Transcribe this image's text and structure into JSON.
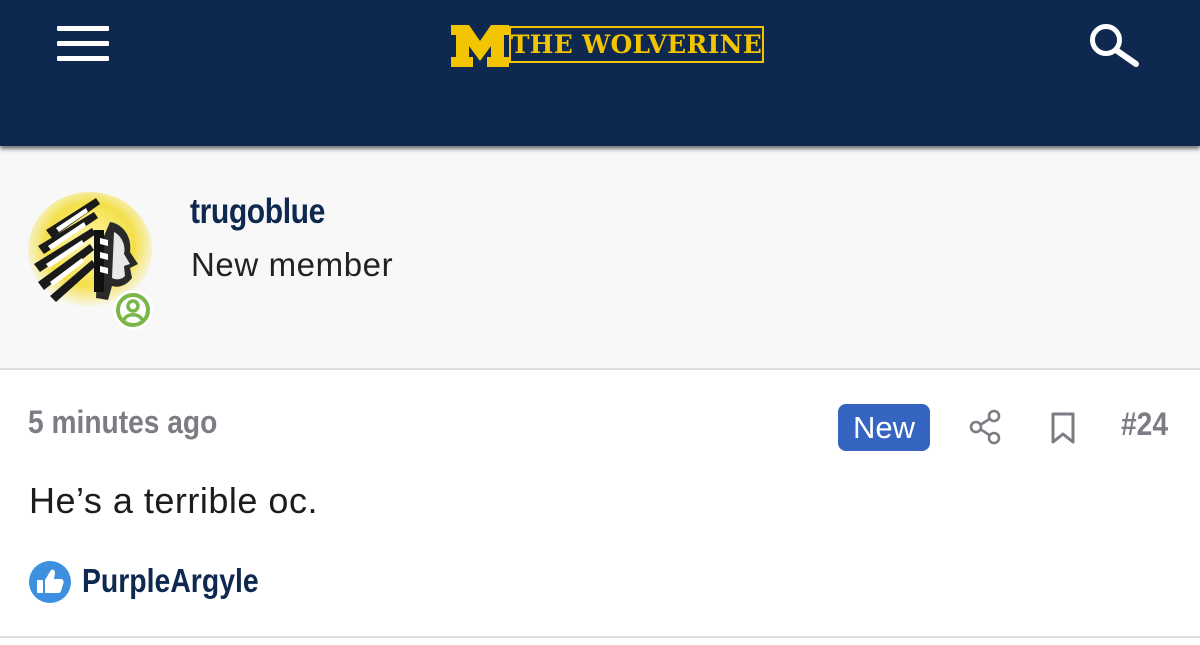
{
  "header": {
    "logo_letter": "M",
    "logo_text": "THE WOLVERINE"
  },
  "member": {
    "username": "trugoblue",
    "role": "New member"
  },
  "post": {
    "timestamp": "5 minutes ago",
    "new_badge": "New",
    "post_number": "#24",
    "body": "He’s a terrible oc.",
    "reactions": [
      "PurpleArgyle"
    ]
  },
  "icons": {
    "menu": "hamburger-icon",
    "search": "search-icon",
    "share": "share-icon",
    "bookmark": "bookmark-icon",
    "like": "thumbs-up-icon",
    "online": "user-status-icon"
  },
  "colors": {
    "header_bg": "#0f2850",
    "brand_maize": "#f2c500",
    "new_badge_bg": "#3565c0",
    "online_green": "#7ab648",
    "like_blue": "#3d8fe0"
  }
}
